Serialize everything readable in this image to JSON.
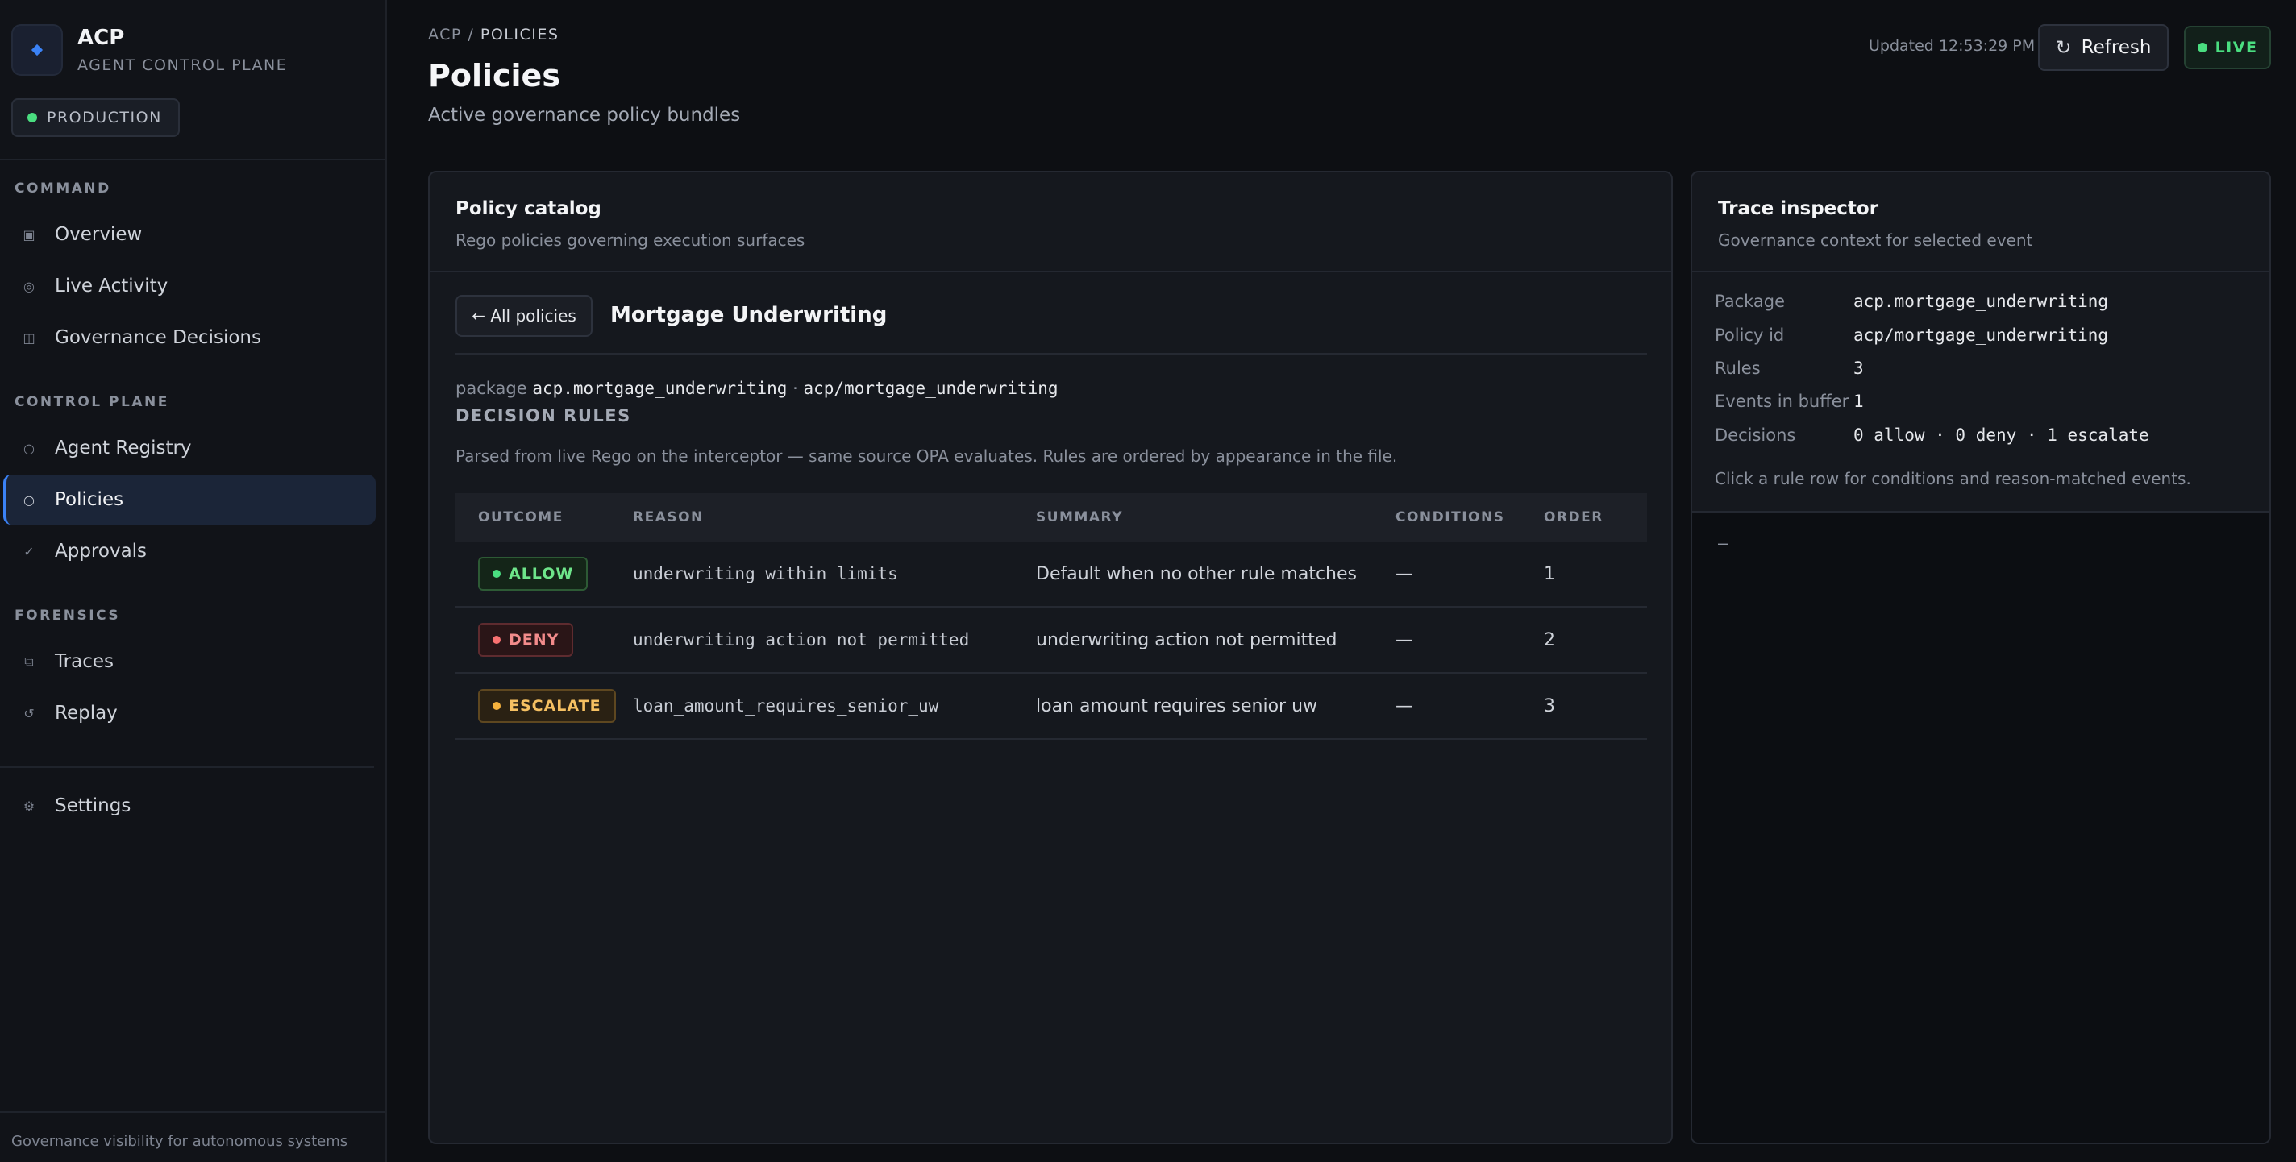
{
  "sidebar": {
    "brand_name": "ACP",
    "brand_sub": "AGENT CONTROL PLANE",
    "env_label": "PRODUCTION",
    "sections": {
      "command": "COMMAND",
      "control_plane": "CONTROL PLANE",
      "forensics": "FORENSICS"
    },
    "items": [
      {
        "label": "Overview",
        "icon": "square-icon"
      },
      {
        "label": "Live Activity",
        "icon": "activity-icon"
      },
      {
        "label": "Governance Decisions",
        "icon": "columns-icon"
      },
      {
        "label": "Agent Registry",
        "icon": "circle-icon"
      },
      {
        "label": "Policies",
        "icon": "circle-icon"
      },
      {
        "label": "Approvals",
        "icon": "check-icon"
      },
      {
        "label": "Traces",
        "icon": "copy-icon"
      },
      {
        "label": "Replay",
        "icon": "replay-icon"
      },
      {
        "label": "Settings",
        "icon": "gear-icon"
      }
    ],
    "active_item": "Policies",
    "footer": "Governance visibility for autonomous systems"
  },
  "header": {
    "breadcrumb_root": "ACP /",
    "breadcrumb_current": "POLICIES",
    "title": "Policies",
    "subtitle": "Active governance policy bundles",
    "updated": "Updated 12:53:29 PM",
    "refresh_label": "Refresh",
    "live_label": "LIVE"
  },
  "catalog": {
    "title": "Policy catalog",
    "subtitle": "Rego policies governing execution surfaces",
    "back_label": "← All policies",
    "policy_name": "Mortgage Underwriting",
    "package_prefix": "package",
    "package_name": "acp.mortgage_underwriting",
    "separator": "·",
    "policy_id": "acp/mortgage_underwriting",
    "rules_label": "DECISION RULES",
    "rules_desc": "Parsed from live Rego on the interceptor — same source OPA evaluates. Rules are ordered by appearance in the file.",
    "columns": [
      "OUTCOME",
      "REASON",
      "SUMMARY",
      "CONDITIONS",
      "ORDER"
    ],
    "rows": [
      {
        "outcome": "ALLOW",
        "reason": "underwriting_within_limits",
        "summary": "Default when no other rule matches",
        "conditions": "—",
        "order": "1"
      },
      {
        "outcome": "DENY",
        "reason": "underwriting_action_not_permitted",
        "summary": "underwriting action not permitted",
        "conditions": "—",
        "order": "2"
      },
      {
        "outcome": "ESCALATE",
        "reason": "loan_amount_requires_senior_uw",
        "summary": "loan amount requires senior uw",
        "conditions": "—",
        "order": "3"
      }
    ]
  },
  "inspector": {
    "title": "Trace inspector",
    "subtitle": "Governance context for selected event",
    "fields": [
      {
        "key": "Package",
        "value": "acp.mortgage_underwriting"
      },
      {
        "key": "Policy id",
        "value": "acp/mortgage_underwriting"
      },
      {
        "key": "Rules",
        "value": "3"
      },
      {
        "key": "Events in buffer",
        "value": "1"
      },
      {
        "key": "Decisions",
        "value": "0 allow · 0 deny · 1 escalate"
      }
    ],
    "hint": "Click a rule row for conditions and reason-matched events.",
    "empty": "—"
  },
  "colors": {
    "accent": "#3b82f6",
    "allow": "#4ade80",
    "deny": "#f87171",
    "escalate": "#f5b13d",
    "background": "#0d0f13"
  }
}
